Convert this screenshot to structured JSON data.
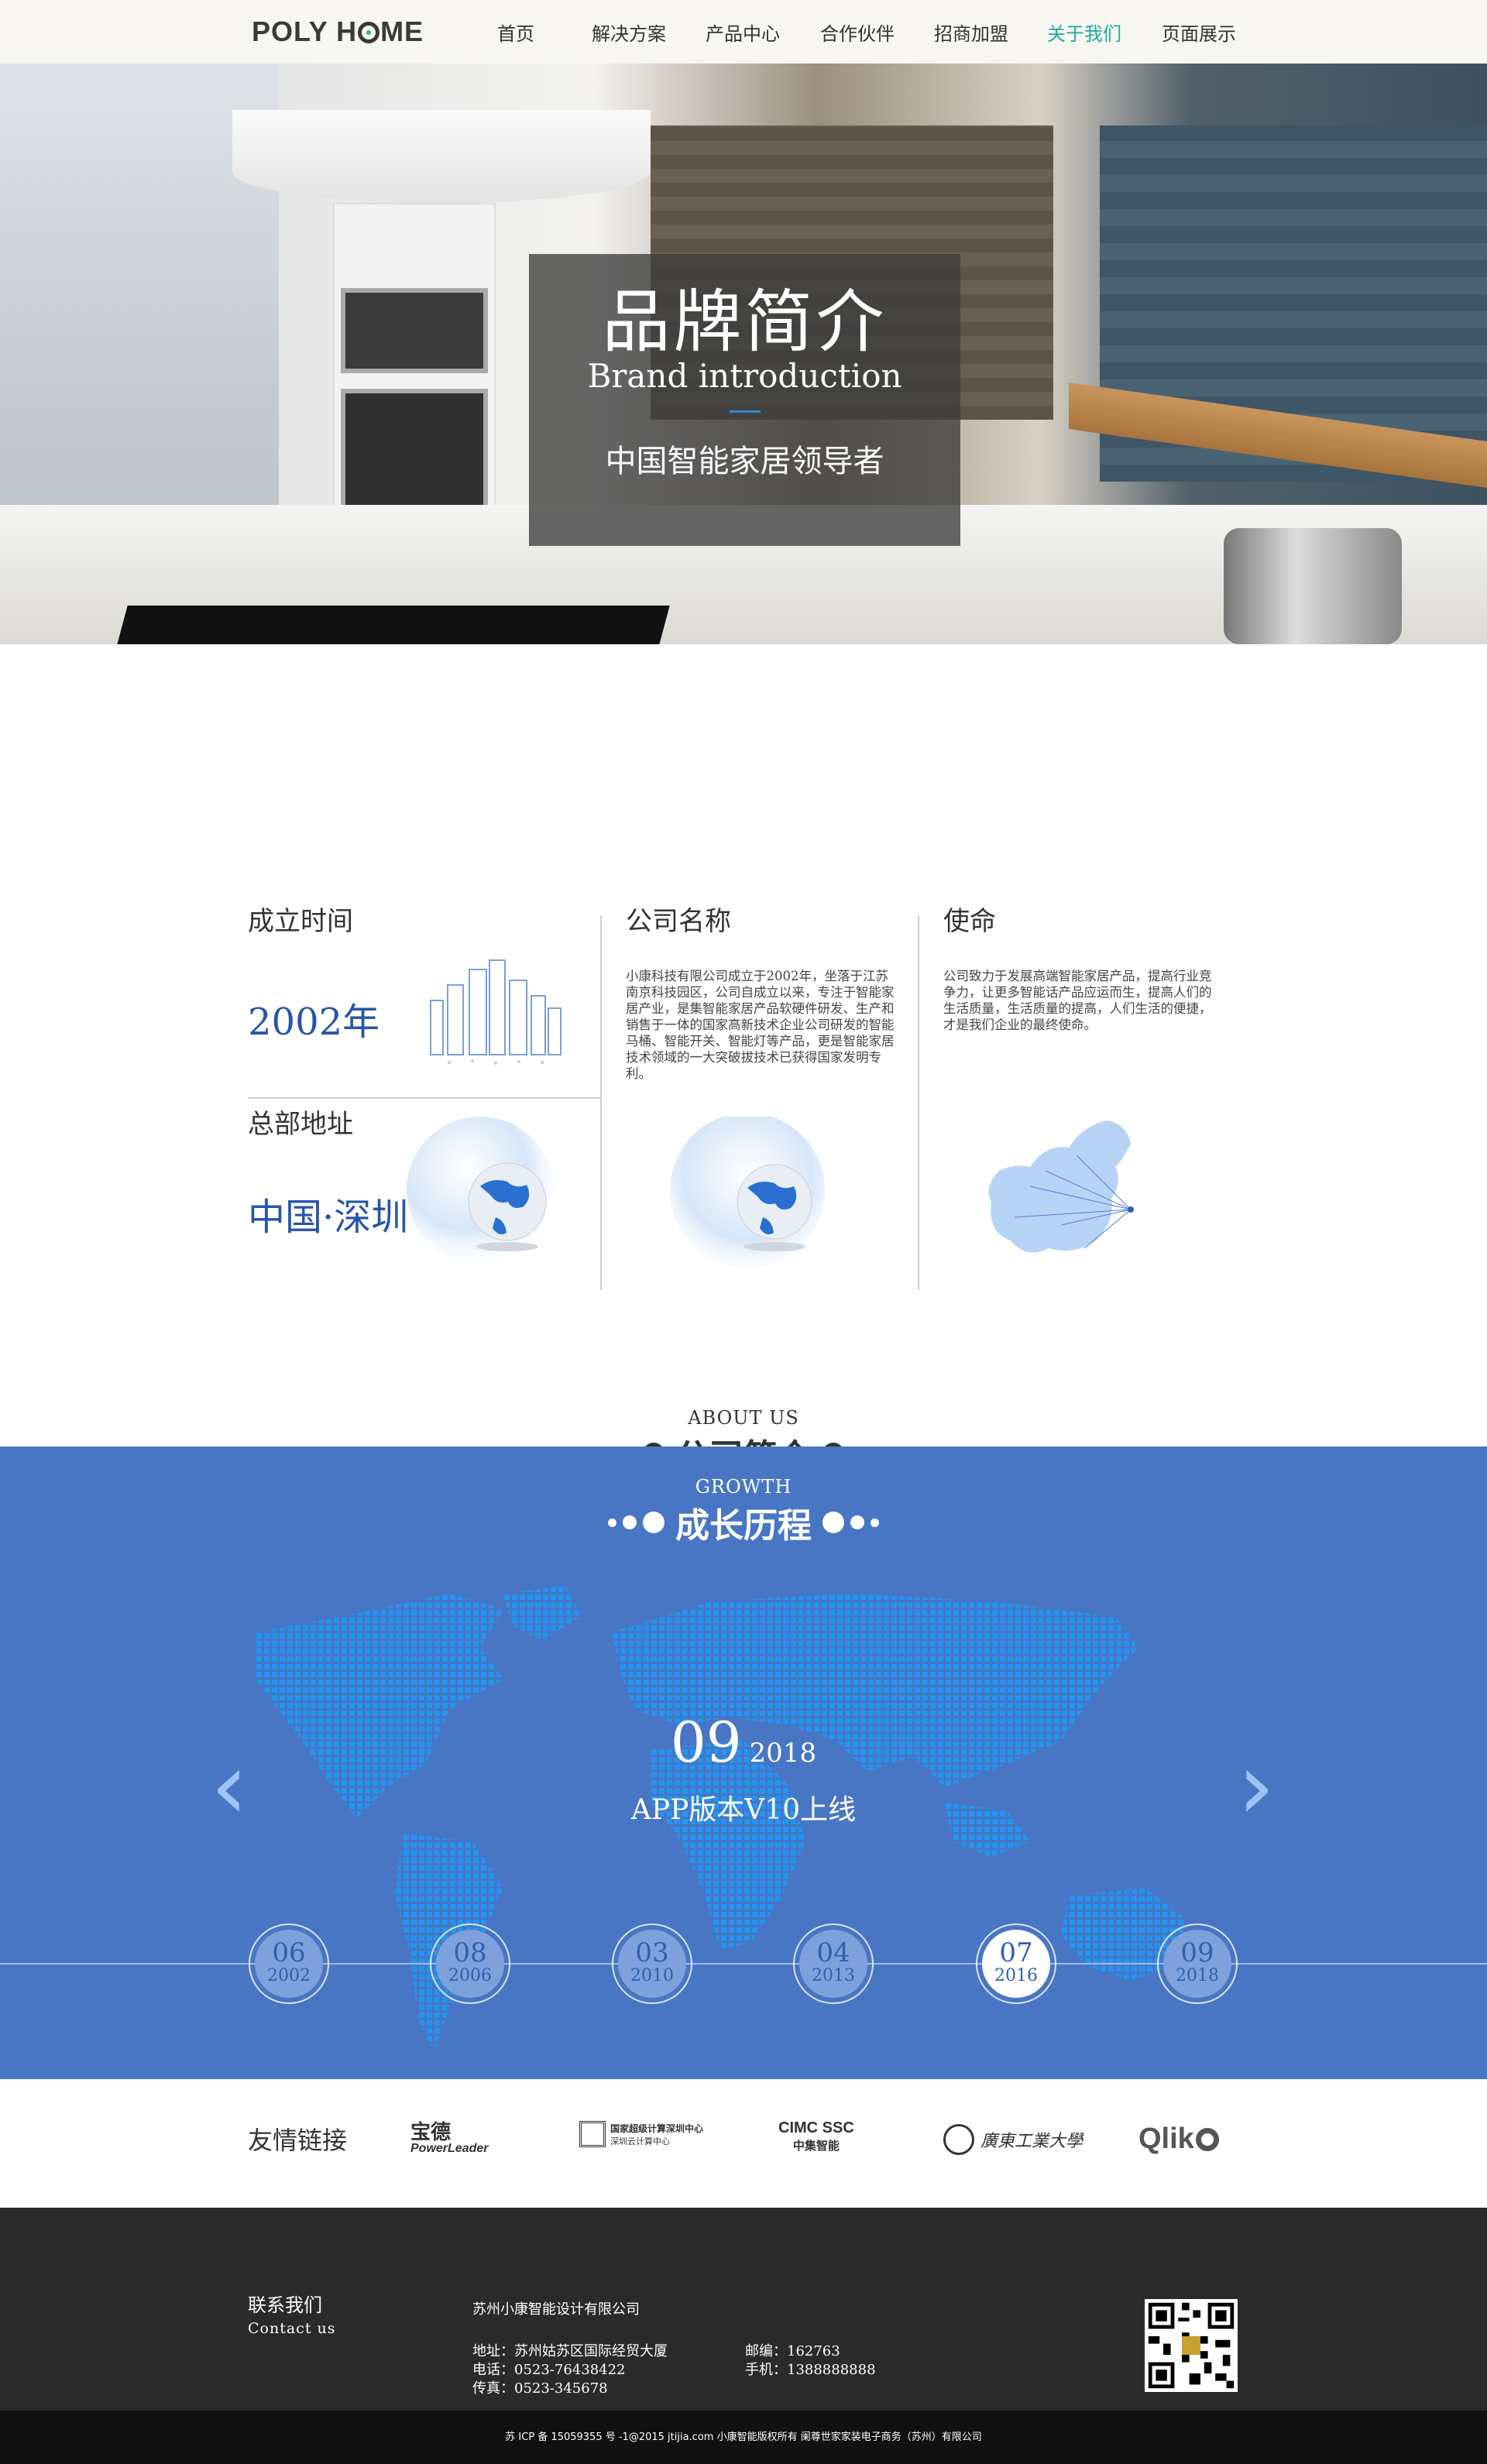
{
  "nav": {
    "logo_left": "POLY H",
    "logo_right": "ME",
    "items": [
      "首页",
      "解决方案",
      "产品中心",
      "合作伙伴",
      "招商加盟",
      "关于我们",
      "页面展示"
    ],
    "active_index": 5,
    "accent_color": "#1eaa9d"
  },
  "hero": {
    "title": "品牌简介",
    "subtitle": "Brand introduction",
    "slogan": "中国智能家居领导者"
  },
  "about": {
    "en": "ABOUT US",
    "cn": "公司简介",
    "founded_label": "成立时间",
    "founded_value": "2002年",
    "hq_label": "总部地址",
    "hq_value": "中国·深圳",
    "name_label": "公司名称",
    "name_text": "小康科技有限公司成立于2002年，坐落于江苏南京科技园区，公司自成立以来，专注于智能家居产业，是集智能家居产品软硬件研发、生产和销售于一体的国家高新技术企业公司研发的智能马桶、智能开关、智能灯等产品，更是智能家居技术领域的一大突破拔技术已获得国家发明专利。",
    "mission_label": "使命",
    "mission_text": "公司致力于发展高端智能家居产品，提高行业竞争力，让更多智能话产品应运而生，提高人们的生活质量，生活质量的提高，人们生活的便捷，才是我们企业的最终使命。"
  },
  "growth": {
    "en": "GROWTH",
    "cn": "成长历程",
    "current_month": "09",
    "current_year": "2018",
    "current_event": "APP版本V10上线",
    "milestones": [
      {
        "month": "06",
        "year": "2002"
      },
      {
        "month": "08",
        "year": "2006"
      },
      {
        "month": "03",
        "year": "2010"
      },
      {
        "month": "04",
        "year": "2013"
      },
      {
        "month": "07",
        "year": "2016"
      },
      {
        "month": "09",
        "year": "2018"
      }
    ],
    "active_index": 4,
    "prev_icon": "chevron-left-icon",
    "next_icon": "chevron-right-icon",
    "bg_color": "#4876c4"
  },
  "links": {
    "title": "友情链接",
    "partners": [
      {
        "name": "宝德",
        "sub": "PowerLeader"
      },
      {
        "name": "国家超级计算深圳中心",
        "sub": "深圳云计算中心"
      },
      {
        "name": "CIMC SSC",
        "sub": "中集智能"
      },
      {
        "name": "廣東工業大學",
        "sub": ""
      },
      {
        "name": "Qlik",
        "sub": ""
      }
    ]
  },
  "footer": {
    "contact_cn": "联系我们",
    "contact_en": "Contact us",
    "company": "苏州小康智能设计有限公司",
    "address": "地址：苏州姑苏区国际经贸大厦",
    "phone": "电话：0523-76438422",
    "fax": "传真：0523-345678",
    "postcode": "邮编：162763",
    "mobile": "手机：1388888888",
    "copyright": "苏 ICP 备 15059355 号 -1@2015 jtijia.com 小康智能版权所有 阑尊世家家装电子商务（苏州）有限公司"
  }
}
